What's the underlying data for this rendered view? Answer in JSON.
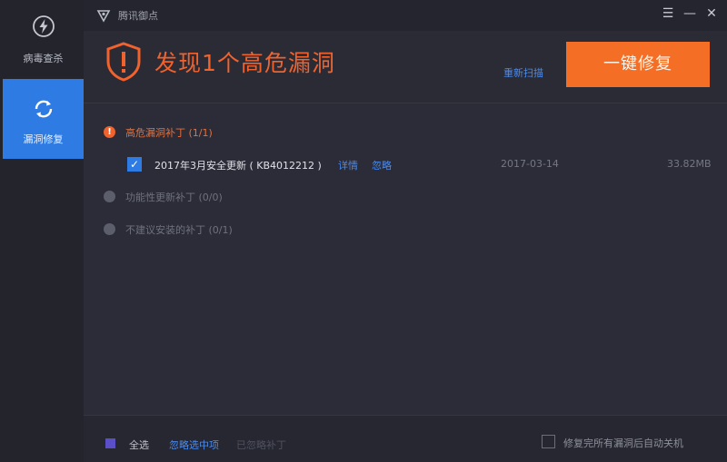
{
  "window": {
    "title": "腾讯御点"
  },
  "sidebar": {
    "items": [
      {
        "label": "病毒查杀",
        "icon": "lightning-icon",
        "active": false
      },
      {
        "label": "漏洞修复",
        "icon": "refresh-icon",
        "active": true
      }
    ]
  },
  "header": {
    "headline": "发现1个高危漏洞",
    "rescan_label": "重新扫描",
    "fix_button_label": "一键修复"
  },
  "categories": [
    {
      "label": "高危漏洞补丁 (1/1)",
      "marker": "!"
    },
    {
      "label": "功能性更新补丁 (0/0)"
    },
    {
      "label": "不建议安装的补丁 (0/1)"
    }
  ],
  "patches": [
    {
      "name": "2017年3月安全更新 ( KB4012212 )",
      "detail_link": "详情",
      "ignore_link": "忽略",
      "date": "2017-03-14",
      "size": "33.82MB",
      "checked": true
    }
  ],
  "footer": {
    "select_all_label": "全选",
    "ignore_selected_label": "忽略选中项",
    "ignored_label": "已忽略补丁",
    "auto_shutdown_label": "修复完所有漏洞后自动关机"
  },
  "colors": {
    "accent_blue": "#2e7be4",
    "danger_orange": "#f46f25",
    "background": "#2b2c37"
  }
}
